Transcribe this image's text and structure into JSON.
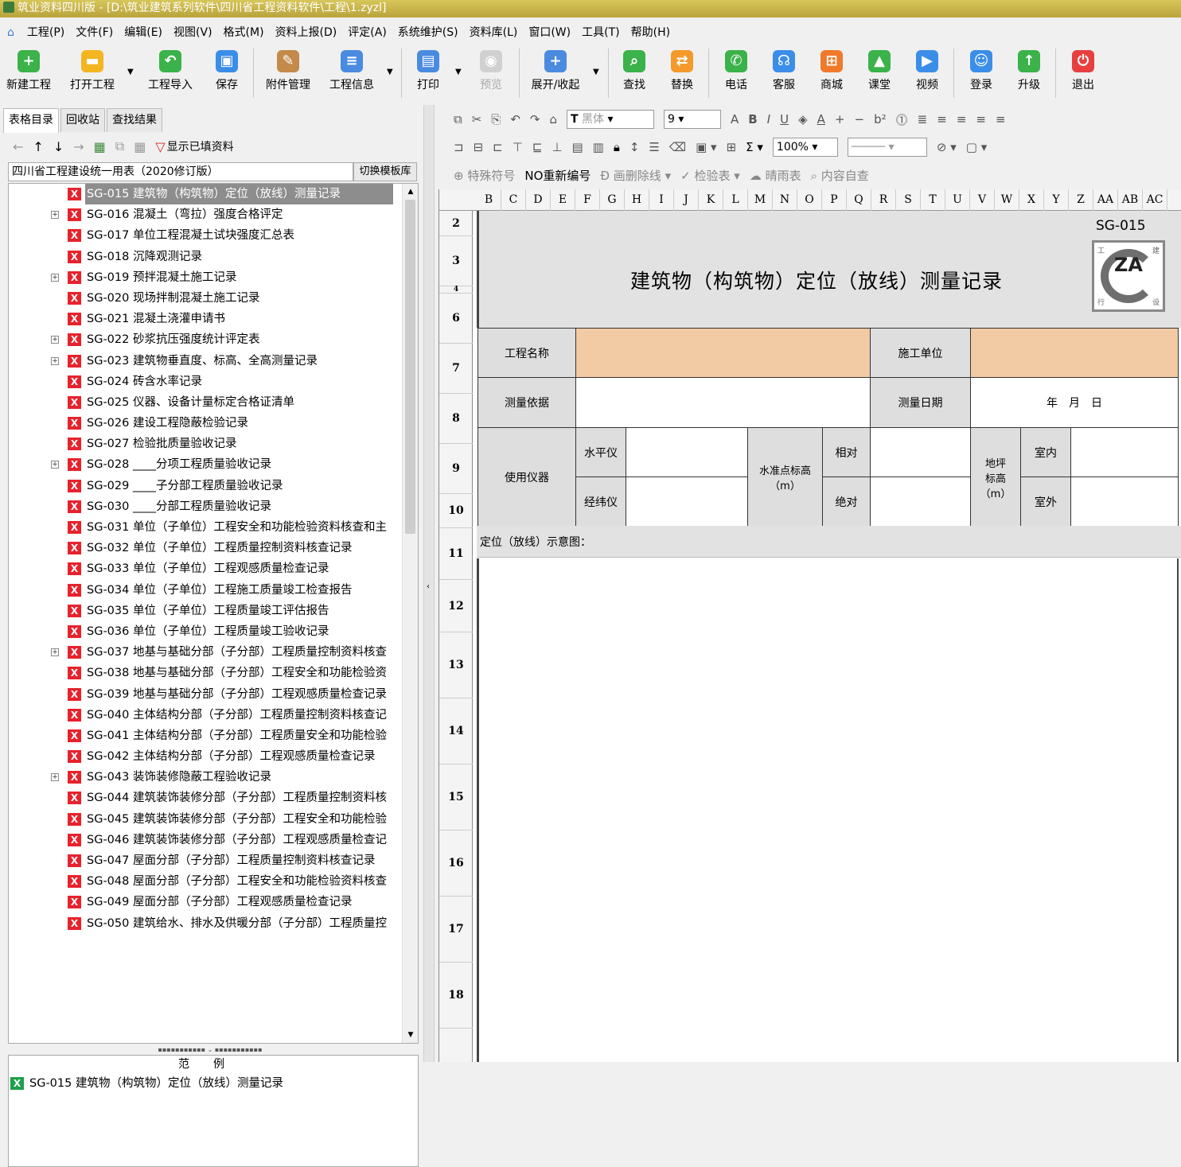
{
  "window": {
    "title": "筑业资料四川版 - [D:\\筑业建筑系列软件\\四川省工程资料软件\\工程\\1.zyzl]"
  },
  "menu": [
    "工程(P)",
    "文件(F)",
    "编辑(E)",
    "视图(V)",
    "格式(M)",
    "资料上报(D)",
    "评定(A)",
    "系统维护(S)",
    "资料库(L)",
    "窗口(W)",
    "工具(T)",
    "帮助(H)"
  ],
  "toolbar": {
    "new_project": "新建工程",
    "open_project": "打开工程",
    "import_project": "工程导入",
    "save": "保存",
    "attachments": "附件管理",
    "project_info": "工程信息",
    "print": "打印",
    "preview": "预览",
    "expand_collapse": "展开/收起",
    "find": "查找",
    "replace": "替换",
    "phone": "电话",
    "service": "客服",
    "mall": "商城",
    "classroom": "课堂",
    "video": "视频",
    "login": "登录",
    "upgrade": "升级",
    "exit": "退出"
  },
  "left": {
    "tabs": [
      "表格目录",
      "回收站",
      "查找结果"
    ],
    "show_filled": "显示已填资料",
    "template_name": "四川省工程建设统一用表（2020修订版）",
    "switch_template": "切换模板库",
    "tree": [
      {
        "label": "SG-015 建筑物（构筑物）定位（放线）测量记录",
        "exp": false,
        "sel": true
      },
      {
        "label": "SG-016 混凝土（弯拉）强度合格评定",
        "exp": true
      },
      {
        "label": "SG-017 单位工程混凝土试块强度汇总表",
        "exp": false
      },
      {
        "label": "SG-018 沉降观测记录",
        "exp": false
      },
      {
        "label": "SG-019 预拌混凝土施工记录",
        "exp": true
      },
      {
        "label": "SG-020 现场拌制混凝土施工记录",
        "exp": false
      },
      {
        "label": "SG-021 混凝土浇灌申请书",
        "exp": false
      },
      {
        "label": "SG-022 砂浆抗压强度统计评定表",
        "exp": true
      },
      {
        "label": "SG-023 建筑物垂直度、标高、全高测量记录",
        "exp": true
      },
      {
        "label": "SG-024 砖含水率记录",
        "exp": false
      },
      {
        "label": "SG-025 仪器、设备计量标定合格证清单",
        "exp": false
      },
      {
        "label": "SG-026 建设工程隐蔽检验记录",
        "exp": false
      },
      {
        "label": "SG-027 检验批质量验收记录",
        "exp": false
      },
      {
        "label": "SG-028 ____分项工程质量验收记录",
        "exp": true
      },
      {
        "label": "SG-029 ____子分部工程质量验收记录",
        "exp": false
      },
      {
        "label": "SG-030 ____分部工程质量验收记录",
        "exp": false
      },
      {
        "label": "SG-031 单位（子单位）工程安全和功能检验资料核查和主",
        "exp": false
      },
      {
        "label": "SG-032 单位（子单位）工程质量控制资料核查记录",
        "exp": false
      },
      {
        "label": "SG-033 单位（子单位）工程观感质量检查记录",
        "exp": false
      },
      {
        "label": "SG-034 单位（子单位）工程施工质量竣工检查报告",
        "exp": false
      },
      {
        "label": "SG-035 单位（子单位）工程质量竣工评估报告",
        "exp": false
      },
      {
        "label": "SG-036 单位（子单位）工程质量竣工验收记录",
        "exp": false
      },
      {
        "label": "SG-037 地基与基础分部（子分部）工程质量控制资料核查",
        "exp": true
      },
      {
        "label": "SG-038 地基与基础分部（子分部）工程安全和功能检验资",
        "exp": false
      },
      {
        "label": "SG-039 地基与基础分部（子分部）工程观感质量检查记录",
        "exp": false
      },
      {
        "label": "SG-040 主体结构分部（子分部）工程质量控制资料核查记",
        "exp": false
      },
      {
        "label": "SG-041 主体结构分部（子分部）工程质量安全和功能检验",
        "exp": false
      },
      {
        "label": "SG-042 主体结构分部（子分部）工程观感质量检查记录",
        "exp": false
      },
      {
        "label": "SG-043 装饰装修隐蔽工程验收记录",
        "exp": true
      },
      {
        "label": "SG-044 建筑装饰装修分部（子分部）工程质量控制资料核",
        "exp": false
      },
      {
        "label": "SG-045 建筑装饰装修分部（子分部）工程安全和功能检验",
        "exp": false
      },
      {
        "label": "SG-046 建筑装饰装修分部（子分部）工程观感质量检查记",
        "exp": false
      },
      {
        "label": "SG-047 屋面分部（子分部）工程质量控制资料核查记录",
        "exp": false
      },
      {
        "label": "SG-048 屋面分部（子分部）工程安全和功能检验资料核查",
        "exp": false
      },
      {
        "label": "SG-049 屋面分部（子分部）工程观感质量检查记录",
        "exp": false
      },
      {
        "label": "SG-050 建筑给水、排水及供暖分部（子分部）工程质量控",
        "exp": false
      }
    ],
    "example_header": "范例",
    "example_item": "SG-015 建筑物（构筑物）定位（放线）测量记录"
  },
  "editor": {
    "font": "黑体",
    "size": "9",
    "zoom": "100%",
    "special_symbol": "特殊符号",
    "renumber": "NO重新编号",
    "strike": "画删除线",
    "inspect": "检验表",
    "weather": "晴雨表",
    "self_check": "内容自查",
    "columns": [
      "B",
      "C",
      "D",
      "E",
      "F",
      "G",
      "H",
      "I",
      "J",
      "K",
      "L",
      "M",
      "N",
      "O",
      "P",
      "Q",
      "R",
      "S",
      "T",
      "U",
      "V",
      "W",
      "X",
      "Y",
      "Z",
      "AA",
      "AB",
      "AC"
    ],
    "rows": [
      "2",
      "3",
      "4",
      "6",
      "7",
      "8",
      "9",
      "10",
      "11",
      "12",
      "13",
      "14",
      "15",
      "16",
      "17",
      "18"
    ]
  },
  "form": {
    "code": "SG-015",
    "title": "建筑物（构筑物）定位（放线）测量记录",
    "logo_text": "ZA",
    "logo_corners": [
      "工",
      "建",
      "行",
      "设"
    ],
    "project_name": "工程名称",
    "construction_unit": "施工单位",
    "basis": "测量依据",
    "date_label": "测量日期",
    "date_value": "年　月　日",
    "instruments": "使用仪器",
    "level": "水平仪",
    "theodolite": "经纬仪",
    "benchmark": "水准点标高（m）",
    "relative": "相对",
    "absolute": "绝对",
    "floor_elev": "地坪标高（m）",
    "indoor": "室内",
    "outdoor": "室外",
    "diagram": "定位（放线）示意图："
  }
}
